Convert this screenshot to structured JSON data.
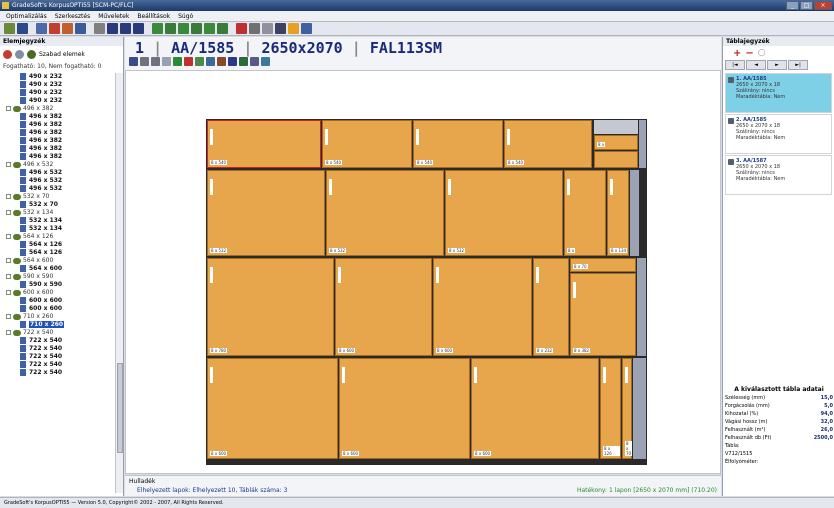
{
  "window": {
    "title": "GradeSoft's KorpusOPTI55 [SCM-PC/FLC]",
    "buttons": [
      "_",
      "□",
      "×"
    ]
  },
  "menu": [
    "Optimalizálás",
    "Szerkesztés",
    "Műveletek",
    "Beállítások",
    "Súgó"
  ],
  "toolbar_colors": [
    "#6a8a3a",
    "#2a4a8a",
    "#4a6aaa",
    "#c04030",
    "#c06030",
    "#3a5a9a",
    "#808080",
    "#2a3a7a",
    "#2a3a7a",
    "#2a3a7a",
    "#3a8a3a",
    "#3a7a3a",
    "#3a8a3a",
    "#3a7a3a",
    "#3a8a3a",
    "#3a7a3a",
    "#c03030",
    "#707070",
    "#9090a0",
    "#404060",
    "#e8a020",
    "#4060a0"
  ],
  "left_panel": {
    "title": "Elemjegyzék",
    "tool_label": "Szabad elemek",
    "filter": "Fogatható: 10, Nem fogatható: 0",
    "tree": [
      {
        "t": "i",
        "label": "490 x 232"
      },
      {
        "t": "i",
        "label": "490 x 232"
      },
      {
        "t": "i",
        "label": "490 x 232"
      },
      {
        "t": "i",
        "label": "490 x 232"
      },
      {
        "t": "g",
        "label": "496 x 382"
      },
      {
        "t": "i",
        "label": "496 x 382"
      },
      {
        "t": "i",
        "label": "496 x 382"
      },
      {
        "t": "i",
        "label": "496 x 382"
      },
      {
        "t": "i",
        "label": "496 x 382"
      },
      {
        "t": "i",
        "label": "496 x 382"
      },
      {
        "t": "i",
        "label": "496 x 382"
      },
      {
        "t": "g",
        "label": "496 x 532"
      },
      {
        "t": "i",
        "label": "496 x 532"
      },
      {
        "t": "i",
        "label": "496 x 532"
      },
      {
        "t": "i",
        "label": "496 x 532"
      },
      {
        "t": "g",
        "label": "532 x 70"
      },
      {
        "t": "i",
        "label": "532 x 70"
      },
      {
        "t": "g",
        "label": "532 x 134"
      },
      {
        "t": "i",
        "label": "532 x 134"
      },
      {
        "t": "i",
        "label": "532 x 134"
      },
      {
        "t": "g",
        "label": "564 x 126"
      },
      {
        "t": "i",
        "label": "564 x 126"
      },
      {
        "t": "i",
        "label": "564 x 126"
      },
      {
        "t": "g",
        "label": "564 x 600"
      },
      {
        "t": "i",
        "label": "564 x 600"
      },
      {
        "t": "g",
        "label": "590 x 590"
      },
      {
        "t": "i",
        "label": "590 x 590"
      },
      {
        "t": "g",
        "label": "600 x 600"
      },
      {
        "t": "i",
        "label": "600 x 600"
      },
      {
        "t": "i",
        "label": "600 x 600"
      },
      {
        "t": "g",
        "label": "710 x 260"
      },
      {
        "t": "i",
        "label": "710 x 260",
        "selected": true
      },
      {
        "t": "g",
        "label": "722 x 540"
      },
      {
        "t": "i",
        "label": "722 x 540"
      },
      {
        "t": "i",
        "label": "722 x 540"
      },
      {
        "t": "i",
        "label": "722 x 540"
      },
      {
        "t": "i",
        "label": "722 x 540"
      },
      {
        "t": "i",
        "label": "722 x 540"
      }
    ]
  },
  "header": {
    "index": "1",
    "material": "AA/1585",
    "size": "2650x2070",
    "code": "FAL113SM"
  },
  "canvas": {
    "pieces": [
      {
        "l": 1,
        "t": 1,
        "w": 114,
        "h": 48,
        "label": "8 x 540",
        "red": true
      },
      {
        "l": 116,
        "t": 1,
        "w": 90,
        "h": 48,
        "label": "8 x 540"
      },
      {
        "l": 207,
        "t": 1,
        "w": 90,
        "h": 48,
        "label": "8 x 540"
      },
      {
        "l": 298,
        "t": 1,
        "w": 88,
        "h": 48,
        "label": "8 x 540"
      },
      {
        "l": 388,
        "t": 16,
        "w": 44,
        "h": 15,
        "label": "8 x"
      },
      {
        "l": 388,
        "t": 32,
        "w": 44,
        "h": 17,
        "label": ""
      },
      {
        "l": 1,
        "t": 51,
        "w": 118,
        "h": 86,
        "label": "8 x 532"
      },
      {
        "l": 120,
        "t": 51,
        "w": 118,
        "h": 86,
        "label": "8 x 532"
      },
      {
        "l": 239,
        "t": 51,
        "w": 118,
        "h": 86,
        "label": "8 x 532"
      },
      {
        "l": 358,
        "t": 51,
        "w": 42,
        "h": 86,
        "label": "8 x"
      },
      {
        "l": 401,
        "t": 51,
        "w": 22,
        "h": 86,
        "label": "8 x 134"
      },
      {
        "l": 1,
        "t": 139,
        "w": 127,
        "h": 98,
        "label": "8 x 780"
      },
      {
        "l": 129,
        "t": 139,
        "w": 97,
        "h": 98,
        "label": "8 x 600"
      },
      {
        "l": 227,
        "t": 139,
        "w": 99,
        "h": 98,
        "label": "8 x 600"
      },
      {
        "l": 327,
        "t": 139,
        "w": 36,
        "h": 98,
        "label": "8 x 232"
      },
      {
        "l": 364,
        "t": 139,
        "w": 66,
        "h": 14,
        "label": "8 x 70"
      },
      {
        "l": 364,
        "t": 154,
        "w": 66,
        "h": 83,
        "label": "8 x 382"
      },
      {
        "l": 1,
        "t": 239,
        "w": 131,
        "h": 101,
        "label": "8 x 600"
      },
      {
        "l": 133,
        "t": 239,
        "w": 131,
        "h": 101,
        "label": "8 x 600"
      },
      {
        "l": 265,
        "t": 239,
        "w": 128,
        "h": 101,
        "label": "8 x 600"
      },
      {
        "l": 394,
        "t": 239,
        "w": 21,
        "h": 101,
        "label": "8 x 126"
      },
      {
        "l": 416,
        "t": 239,
        "w": 10,
        "h": 101,
        "label": "8 x 70"
      }
    ],
    "status_line1": "Hulladék",
    "status_line2": "Elhelyezett lapok: Elhelyezett 10, Táblák száma: 3",
    "status_right": "Hatékony: 1 lapon [2650 x 2070 mm] (710.20)"
  },
  "right_panel": {
    "title": "Táblajegyzék",
    "nav": [
      "|◄",
      "◄",
      "►",
      "►|"
    ],
    "sheets": [
      {
        "title": "1. AA/1585",
        "l1": "2650 x 2070 x 18",
        "l2": "Szálirány: nincs",
        "l3": "Maradéktábla: Nem",
        "active": true
      },
      {
        "title": "2. AA/1585",
        "l1": "2650 x 2070 x 18",
        "l2": "Szálirány: nincs",
        "l3": "Maradéktábla: Nem",
        "active": false
      },
      {
        "title": "3. AA/1587",
        "l1": "2650 x 2070 x 18",
        "l2": "Szálirány: nincs",
        "l3": "Maradéktábla: Nem",
        "active": false
      }
    ],
    "stats_title": "A kiválasztott tábla adatai",
    "stats": [
      {
        "k": "Szélesség (mm)",
        "v": "15,0"
      },
      {
        "k": "Forgácsolás (mm)",
        "v": "5,0"
      },
      {
        "k": "Kihozatal (%)",
        "v": "94,0"
      },
      {
        "k": "Vágási hossz (m)",
        "v": "32,0"
      },
      {
        "k": "Felhasznált (m²)",
        "v": "26,0"
      },
      {
        "k": "Felhasznált db (Ft)",
        "v": "2500,0"
      },
      {
        "k": "Tábla:",
        "v": ""
      },
      {
        "k": "V712/1515",
        "v": ""
      },
      {
        "k": "Élfolyóméter:",
        "v": ""
      }
    ]
  },
  "statusbar": "GradeSoft's KorpusOPTI55 — Version 5.0, Copyright© 2002 - 2007, All Rights Reserved."
}
